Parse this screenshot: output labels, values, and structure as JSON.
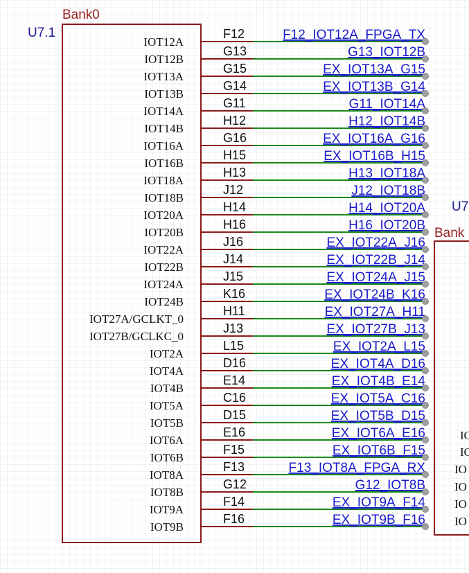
{
  "component": {
    "designator": "U7.1",
    "bank": "Bank0",
    "pins": [
      {
        "name": "IOT12A",
        "number": "F12",
        "net": "F12_IOT12A_FPGA_TX"
      },
      {
        "name": "IOT12B",
        "number": "G13",
        "net": "G13_IOT12B"
      },
      {
        "name": "IOT13A",
        "number": "G15",
        "net": "EX_IOT13A_G15"
      },
      {
        "name": "IOT13B",
        "number": "G14",
        "net": "EX_IOT13B_G14"
      },
      {
        "name": "IOT14A",
        "number": "G11",
        "net": "G11_IOT14A"
      },
      {
        "name": "IOT14B",
        "number": "H12",
        "net": "H12_IOT14B"
      },
      {
        "name": "IOT16A",
        "number": "G16",
        "net": "EX_IOT16A_G16"
      },
      {
        "name": "IOT16B",
        "number": "H15",
        "net": "EX_IOT16B_H15"
      },
      {
        "name": "IOT18A",
        "number": "H13",
        "net": "H13_IOT18A"
      },
      {
        "name": "IOT18B",
        "number": "J12",
        "net": "J12_IOT18B"
      },
      {
        "name": "IOT20A",
        "number": "H14",
        "net": "H14_IOT20A"
      },
      {
        "name": "IOT20B",
        "number": "H16",
        "net": "H16_IOT20B"
      },
      {
        "name": "IOT22A",
        "number": "J16",
        "net": "EX_IOT22A_J16"
      },
      {
        "name": "IOT22B",
        "number": "J14",
        "net": "EX_IOT22B_J14"
      },
      {
        "name": "IOT24A",
        "number": "J15",
        "net": "EX_IOT24A_J15"
      },
      {
        "name": "IOT24B",
        "number": "K16",
        "net": "EX_IOT24B_K16"
      },
      {
        "name": "IOT27A/GCLKT_0",
        "number": "H11",
        "net": "EX_IOT27A_H11"
      },
      {
        "name": "IOT27B/GCLKC_0",
        "number": "J13",
        "net": "EX_IOT27B_J13"
      },
      {
        "name": "IOT2A",
        "number": "L15",
        "net": "EX_IOT2A_L15"
      },
      {
        "name": "IOT4A",
        "number": "D16",
        "net": "EX_IOT4A_D16"
      },
      {
        "name": "IOT4B",
        "number": "E14",
        "net": "EX_IOT4B_E14"
      },
      {
        "name": "IOT5A",
        "number": "C16",
        "net": "EX_IOT5A_C16"
      },
      {
        "name": "IOT5B",
        "number": "D15",
        "net": "EX_IOT5B_D15"
      },
      {
        "name": "IOT6A",
        "number": "E16",
        "net": "EX_IOT6A_E16"
      },
      {
        "name": "IOT6B",
        "number": "F15",
        "net": "EX_IOT6B_F15"
      },
      {
        "name": "IOT8A",
        "number": "F13",
        "net": "F13_IOT8A_FPGA_RX"
      },
      {
        "name": "IOT8B",
        "number": "G12",
        "net": "G12_IOT8B"
      },
      {
        "name": "IOT9A",
        "number": "F14",
        "net": "EX_IOT9A_F14"
      },
      {
        "name": "IOT9B",
        "number": "F16",
        "net": "EX_IOT9B_F16"
      }
    ]
  },
  "second_component": {
    "designator": "U7",
    "bank": "Bank",
    "pin_fragments": [
      "IO",
      "IO",
      "IO",
      "IO",
      "IO",
      "IO"
    ]
  },
  "colors": {
    "grid": "#e8e8e8",
    "body_outline": "#8b1a1a",
    "pin_line": "#8b1a1a",
    "wire": "#1a8a1a",
    "net_label": "#1a1acd",
    "designator": "#1a1a99",
    "bank_label": "#9a2020",
    "pin_text": "#111111",
    "junction": "#a0a0a0"
  }
}
